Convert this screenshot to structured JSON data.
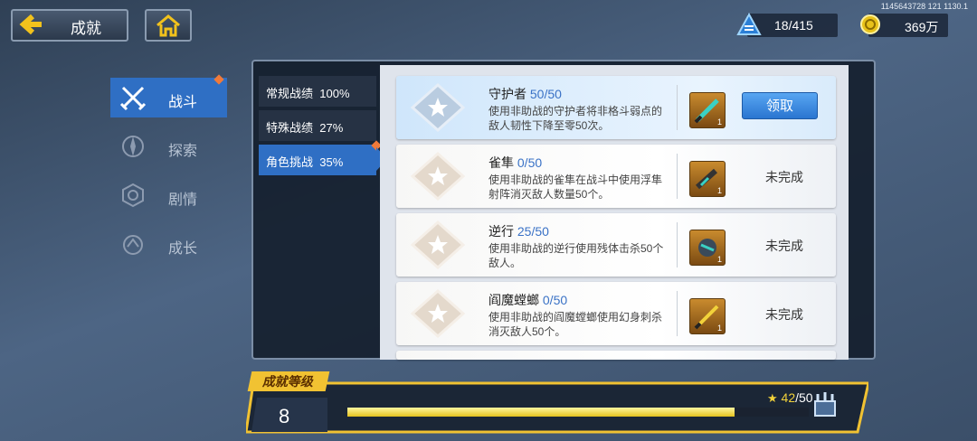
{
  "header": {
    "title": "成就",
    "uid": "1145643728 121 1130.1",
    "stamina": "18/415",
    "coins": "369万"
  },
  "nav": [
    {
      "label": "战斗",
      "active": true
    },
    {
      "label": "探索",
      "active": false
    },
    {
      "label": "剧情",
      "active": false
    },
    {
      "label": "成长",
      "active": false
    }
  ],
  "categories": [
    {
      "label": "常规战绩",
      "percent": "100%"
    },
    {
      "label": "特殊战绩",
      "percent": "27%"
    },
    {
      "label": "角色挑战",
      "percent": "35%"
    }
  ],
  "achievements": [
    {
      "title": "守护者",
      "progress": "50/50",
      "desc": "使用非助战的守护者将非格斗弱点的敌人韧性下降至零50次。",
      "reward_count": "1",
      "action": "领取"
    },
    {
      "title": "雀隼",
      "progress": "0/50",
      "desc": "使用非助战的雀隼在战斗中使用浮隼射阵消灭敌人数量50个。",
      "reward_count": "1",
      "status": "未完成"
    },
    {
      "title": "逆行",
      "progress": "25/50",
      "desc": "使用非助战的逆行使用残体击杀50个敌人。",
      "reward_count": "1",
      "status": "未完成"
    },
    {
      "title": "阎魔螳螂",
      "progress": "0/50",
      "desc": "使用非助战的阎魔螳螂使用幻身刺杀消灭敌人50个。",
      "reward_count": "1",
      "status": "未完成"
    }
  ],
  "level": {
    "label": "成就等级",
    "value": "8",
    "xp_current": "42",
    "xp_max": "/50",
    "xp_fraction": 0.84
  },
  "colors": {
    "accent": "#2f6fc4",
    "gold": "#f1c232",
    "alert": "#f07a3a"
  }
}
